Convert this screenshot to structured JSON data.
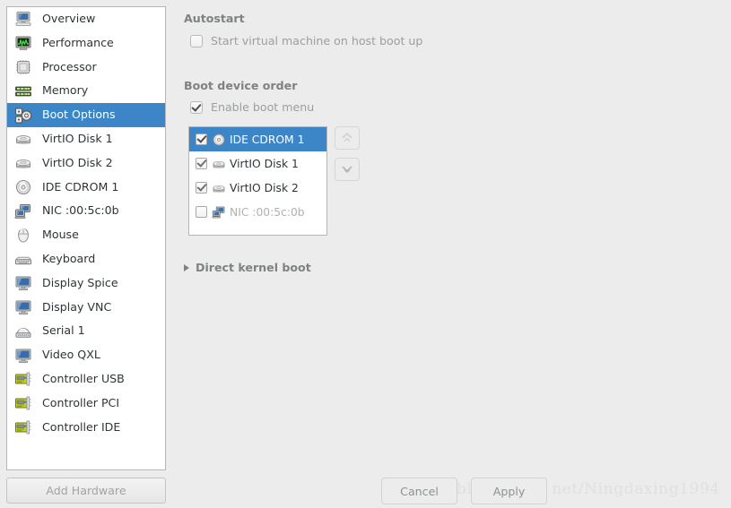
{
  "sidebar": {
    "items": [
      {
        "label": "Overview",
        "icon": "computer-icon",
        "selected": false
      },
      {
        "label": "Performance",
        "icon": "chart-monitor-icon",
        "selected": false
      },
      {
        "label": "Processor",
        "icon": "cpu-chip-icon",
        "selected": false
      },
      {
        "label": "Memory",
        "icon": "memory-ram-icon",
        "selected": false
      },
      {
        "label": "Boot Options",
        "icon": "boot-gears-icon",
        "selected": true
      },
      {
        "label": "VirtIO Disk 1",
        "icon": "harddisk-icon",
        "selected": false
      },
      {
        "label": "VirtIO Disk 2",
        "icon": "harddisk-icon",
        "selected": false
      },
      {
        "label": "IDE CDROM 1",
        "icon": "cdrom-disc-icon",
        "selected": false
      },
      {
        "label": "NIC :00:5c:0b",
        "icon": "network-card-icon",
        "selected": false
      },
      {
        "label": "Mouse",
        "icon": "mouse-icon",
        "selected": false
      },
      {
        "label": "Keyboard",
        "icon": "keyboard-icon",
        "selected": false
      },
      {
        "label": "Display Spice",
        "icon": "display-icon",
        "selected": false
      },
      {
        "label": "Display VNC",
        "icon": "display-icon",
        "selected": false
      },
      {
        "label": "Serial 1",
        "icon": "serial-port-icon",
        "selected": false
      },
      {
        "label": "Video QXL",
        "icon": "display-icon",
        "selected": false
      },
      {
        "label": "Controller USB",
        "icon": "pci-card-icon",
        "selected": false
      },
      {
        "label": "Controller PCI",
        "icon": "pci-card-icon",
        "selected": false
      },
      {
        "label": "Controller IDE",
        "icon": "pci-card-icon",
        "selected": false
      }
    ],
    "add_hardware_label": "Add Hardware"
  },
  "main": {
    "autostart": {
      "title": "Autostart",
      "checkbox_label": "Start virtual machine on host boot up",
      "checked": false
    },
    "boot_device_order": {
      "title": "Boot device order",
      "enable_boot_menu_label": "Enable boot menu",
      "enable_boot_menu_checked": true,
      "devices": [
        {
          "label": "IDE CDROM 1",
          "icon": "cdrom-disc-icon",
          "checked": true,
          "selected": true,
          "dimmed": false
        },
        {
          "label": "VirtIO Disk 1",
          "icon": "harddisk-icon",
          "checked": true,
          "selected": false,
          "dimmed": false
        },
        {
          "label": "VirtIO Disk 2",
          "icon": "harddisk-icon",
          "checked": true,
          "selected": false,
          "dimmed": false
        },
        {
          "label": "NIC :00:5c:0b",
          "icon": "network-card-icon",
          "checked": false,
          "selected": false,
          "dimmed": true
        }
      ],
      "move_up_icon": "arrow-up-icon",
      "move_down_icon": "arrow-down-icon"
    },
    "direct_kernel_boot": {
      "label": "Direct kernel boot",
      "expander_icon": "triangle-right-icon",
      "expanded": false
    }
  },
  "footer": {
    "cancel_label": "Cancel",
    "apply_label": "Apply"
  },
  "watermark": {
    "text": "http://blog. csdn. net/Ningdaxing1994"
  },
  "colors": {
    "selection_blue": "#3c86c8",
    "window_background": "#ececec",
    "list_background": "#ffffff",
    "label_gray": "#7e8282",
    "disabled_text": "#9b9f9f"
  }
}
